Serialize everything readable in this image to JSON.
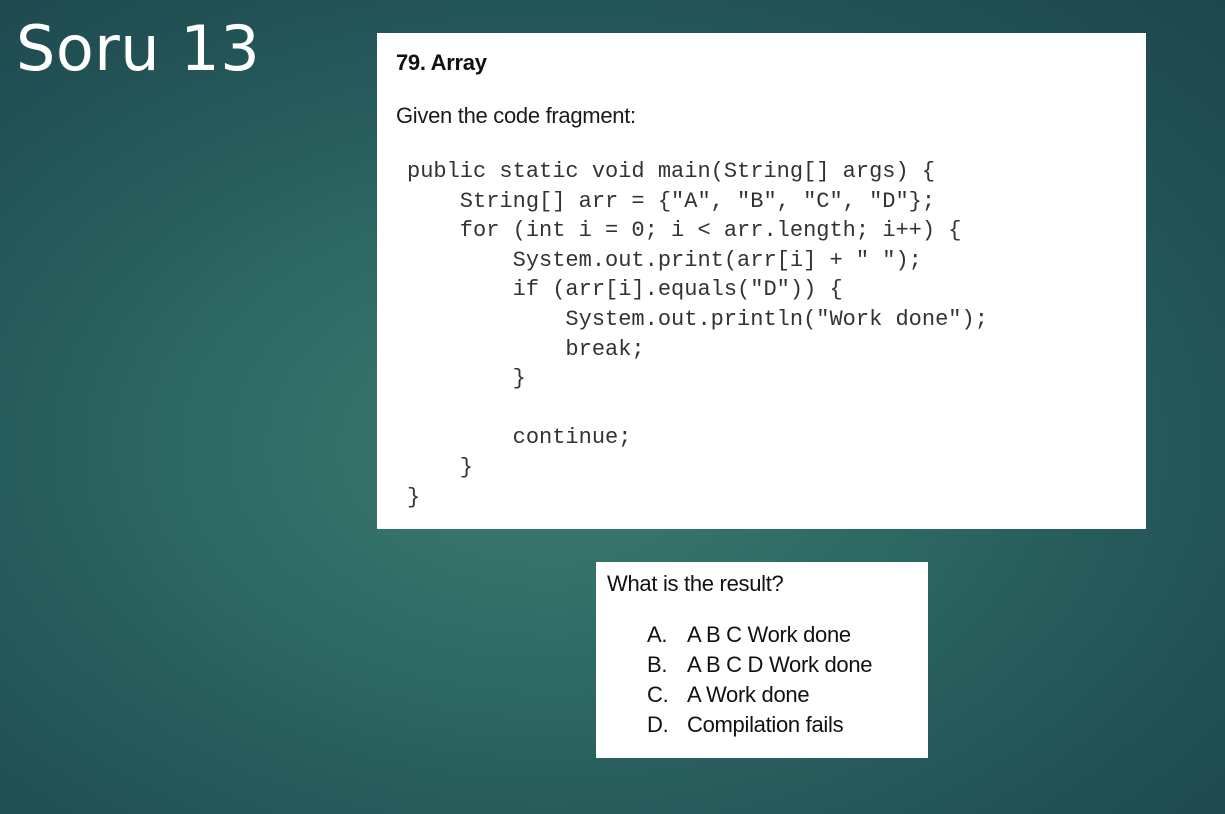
{
  "slide": {
    "title": "Soru 13"
  },
  "question": {
    "heading": "79. Array",
    "intro": "Given the code fragment:",
    "code": "public static void main(String[] args) {\n    String[] arr = {\"A\", \"B\", \"C\", \"D\"};\n    for (int i = 0; i < arr.length; i++) {\n        System.out.print(arr[i] + \" \");\n        if (arr[i].equals(\"D\")) {\n            System.out.println(\"Work done\");\n            break;\n        }\n\n        continue;\n    }\n}"
  },
  "answers": {
    "prompt": "What is the result?",
    "options": [
      {
        "letter": "A.",
        "text": "A B C Work done"
      },
      {
        "letter": "B.",
        "text": "A B C D Work done"
      },
      {
        "letter": "C.",
        "text": "A Work done"
      },
      {
        "letter": "D.",
        "text": "Compilation fails"
      }
    ]
  },
  "colors": {
    "background": "#2e6a64",
    "panel": "#ffffff",
    "code_text": "#333333",
    "title_text": "#ffffff"
  }
}
